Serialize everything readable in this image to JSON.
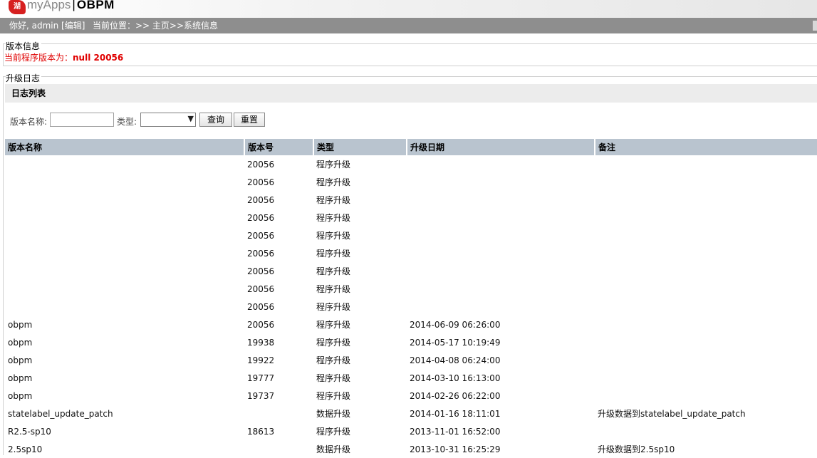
{
  "header": {
    "logo_glyph": "湖",
    "brand": "myApps",
    "separator": "|",
    "product": "OBPM"
  },
  "nav": {
    "greeting": "你好, admin [编辑]",
    "breadcrumb": "当前位置：>> 主页>>系统信息"
  },
  "version_info": {
    "title": "版本信息",
    "label": "当前程序版本为：",
    "value": "null 20056"
  },
  "upgrade_log": {
    "title": "升级日志",
    "list_title": "日志列表",
    "filter": {
      "name_label": "版本名称:",
      "name_value": "",
      "type_label": "类型:",
      "type_selected": "",
      "query_button": "查询",
      "reset_button": "重置"
    },
    "columns": [
      "版本名称",
      "版本号",
      "类型",
      "升级日期",
      "备注"
    ],
    "rows": [
      [
        "",
        "20056",
        "程序升级",
        "",
        ""
      ],
      [
        "",
        "20056",
        "程序升级",
        "",
        ""
      ],
      [
        "",
        "20056",
        "程序升级",
        "",
        ""
      ],
      [
        "",
        "20056",
        "程序升级",
        "",
        ""
      ],
      [
        "",
        "20056",
        "程序升级",
        "",
        ""
      ],
      [
        "",
        "20056",
        "程序升级",
        "",
        ""
      ],
      [
        "",
        "20056",
        "程序升级",
        "",
        ""
      ],
      [
        "",
        "20056",
        "程序升级",
        "",
        ""
      ],
      [
        "",
        "20056",
        "程序升级",
        "",
        ""
      ],
      [
        "obpm",
        "20056",
        "程序升级",
        "2014-06-09 06:26:00",
        ""
      ],
      [
        "obpm",
        "19938",
        "程序升级",
        "2014-05-17 10:19:49",
        ""
      ],
      [
        "obpm",
        "19922",
        "程序升级",
        "2014-04-08 06:24:00",
        ""
      ],
      [
        "obpm",
        "19777",
        "程序升级",
        "2014-03-10 16:13:00",
        ""
      ],
      [
        "obpm",
        "19737",
        "程序升级",
        "2014-02-26 06:22:00",
        ""
      ],
      [
        "statelabel_update_patch",
        "",
        "数据升级",
        "2014-01-16 18:11:01",
        "升级数据到statelabel_update_patch"
      ],
      [
        "R2.5-sp10",
        "18613",
        "程序升级",
        "2013-11-01 16:52:00",
        ""
      ],
      [
        "2.5sp10",
        "",
        "数据升级",
        "2013-10-31 16:25:29",
        "升级数据到2.5sp10"
      ]
    ]
  },
  "colors": {
    "nav_bg": "#8e8e8e",
    "table_header_bg": "#b9c4cf",
    "version_text": "#e00000",
    "logo_red": "#d61f1f"
  }
}
